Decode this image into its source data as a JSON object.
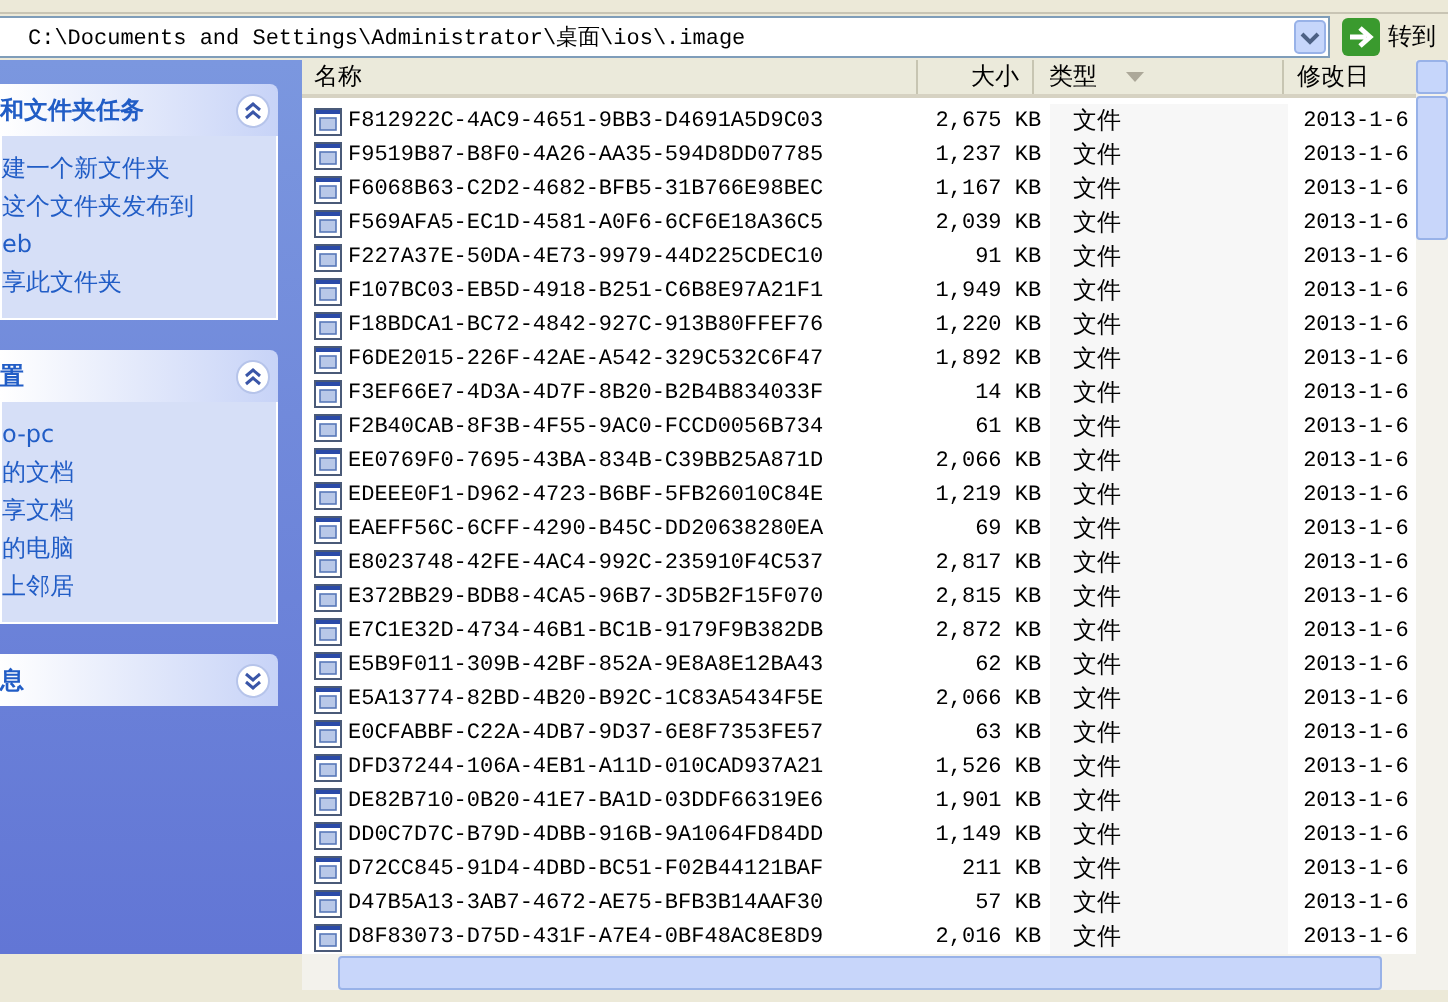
{
  "address_bar": {
    "path": "C:\\Documents and Settings\\Administrator\\桌面\\ios\\.image",
    "go_label": "转到"
  },
  "sidebar": {
    "panels": [
      {
        "title": "和文件夹任务",
        "expanded": true,
        "items": [
          "建一个新文件夹",
          "这个文件夹发布到",
          "eb",
          "享此文件夹"
        ]
      },
      {
        "title": "置",
        "expanded": true,
        "items": [
          "o-pc",
          "的文档",
          "享文档",
          "的电脑",
          "上邻居"
        ]
      },
      {
        "title": "息",
        "expanded": false
      }
    ]
  },
  "table": {
    "columns": [
      {
        "label": "名称",
        "sorted": false
      },
      {
        "label": "大小",
        "sorted": false
      },
      {
        "label": "类型",
        "sorted": true
      },
      {
        "label": "修改日",
        "sorted": false
      }
    ],
    "rows": [
      {
        "name": "F812922C-4AC9-4651-9BB3-D4691A5D9C03",
        "size": "2,675 KB",
        "type": "文件",
        "date": "2013-1-6"
      },
      {
        "name": "F9519B87-B8F0-4A26-AA35-594D8DD07785",
        "size": "1,237 KB",
        "type": "文件",
        "date": "2013-1-6"
      },
      {
        "name": "F6068B63-C2D2-4682-BFB5-31B766E98BEC",
        "size": "1,167 KB",
        "type": "文件",
        "date": "2013-1-6"
      },
      {
        "name": "F569AFA5-EC1D-4581-A0F6-6CF6E18A36C5",
        "size": "2,039 KB",
        "type": "文件",
        "date": "2013-1-6"
      },
      {
        "name": "F227A37E-50DA-4E73-9979-44D225CDEC10",
        "size": "91 KB",
        "type": "文件",
        "date": "2013-1-6"
      },
      {
        "name": "F107BC03-EB5D-4918-B251-C6B8E97A21F1",
        "size": "1,949 KB",
        "type": "文件",
        "date": "2013-1-6"
      },
      {
        "name": "F18BDCA1-BC72-4842-927C-913B80FFEF76",
        "size": "1,220 KB",
        "type": "文件",
        "date": "2013-1-6"
      },
      {
        "name": "F6DE2015-226F-42AE-A542-329C532C6F47",
        "size": "1,892 KB",
        "type": "文件",
        "date": "2013-1-6"
      },
      {
        "name": "F3EF66E7-4D3A-4D7F-8B20-B2B4B834033F",
        "size": "14 KB",
        "type": "文件",
        "date": "2013-1-6"
      },
      {
        "name": "F2B40CAB-8F3B-4F55-9AC0-FCCD0056B734",
        "size": "61 KB",
        "type": "文件",
        "date": "2013-1-6"
      },
      {
        "name": "EE0769F0-7695-43BA-834B-C39BB25A871D",
        "size": "2,066 KB",
        "type": "文件",
        "date": "2013-1-6"
      },
      {
        "name": "EDEEE0F1-D962-4723-B6BF-5FB26010C84E",
        "size": "1,219 KB",
        "type": "文件",
        "date": "2013-1-6"
      },
      {
        "name": "EAEFF56C-6CFF-4290-B45C-DD20638280EA",
        "size": "69 KB",
        "type": "文件",
        "date": "2013-1-6"
      },
      {
        "name": "E8023748-42FE-4AC4-992C-235910F4C537",
        "size": "2,817 KB",
        "type": "文件",
        "date": "2013-1-6"
      },
      {
        "name": "E372BB29-BDB8-4CA5-96B7-3D5B2F15F070",
        "size": "2,815 KB",
        "type": "文件",
        "date": "2013-1-6"
      },
      {
        "name": "E7C1E32D-4734-46B1-BC1B-9179F9B382DB",
        "size": "2,872 KB",
        "type": "文件",
        "date": "2013-1-6"
      },
      {
        "name": "E5B9F011-309B-42BF-852A-9E8A8E12BA43",
        "size": "62 KB",
        "type": "文件",
        "date": "2013-1-6"
      },
      {
        "name": "E5A13774-82BD-4B20-B92C-1C83A5434F5E",
        "size": "2,066 KB",
        "type": "文件",
        "date": "2013-1-6"
      },
      {
        "name": "E0CFABBF-C22A-4DB7-9D37-6E8F7353FE57",
        "size": "63 KB",
        "type": "文件",
        "date": "2013-1-6"
      },
      {
        "name": "DFD37244-106A-4EB1-A11D-010CAD937A21",
        "size": "1,526 KB",
        "type": "文件",
        "date": "2013-1-6"
      },
      {
        "name": "DE82B710-0B20-41E7-BA1D-03DDF66319E6",
        "size": "1,901 KB",
        "type": "文件",
        "date": "2013-1-6"
      },
      {
        "name": "DD0C7D7C-B79D-4DBB-916B-9A1064FD84DD",
        "size": "1,149 KB",
        "type": "文件",
        "date": "2013-1-6"
      },
      {
        "name": "D72CC845-91D4-4DBD-BC51-F02B44121BAF",
        "size": "211 KB",
        "type": "文件",
        "date": "2013-1-6"
      },
      {
        "name": "D47B5A13-3AB7-4672-AE75-BFB3B14AAF30",
        "size": "57 KB",
        "type": "文件",
        "date": "2013-1-6"
      },
      {
        "name": "D8F83073-D75D-431F-A7E4-0BF48AC8E8D9",
        "size": "2,016 KB",
        "type": "文件",
        "date": "2013-1-6"
      }
    ]
  }
}
